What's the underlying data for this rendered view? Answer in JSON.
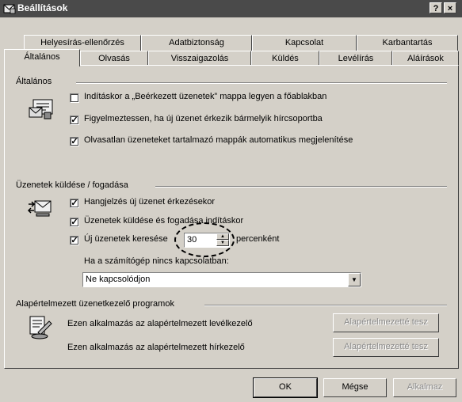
{
  "window": {
    "title": "Beállítások",
    "help_button": "?",
    "close_button": "×"
  },
  "tabs_row1": [
    "Helyesírás-ellenőrzés",
    "Adatbiztonság",
    "Kapcsolat",
    "Karbantartás"
  ],
  "tabs_row2": [
    "Általános",
    "Olvasás",
    "Visszaigazolás",
    "Küldés",
    "Levélírás",
    "Aláírások"
  ],
  "active_tab": "Általános",
  "general": {
    "heading": "Általános",
    "options": [
      {
        "label": "Indításkor a „Beérkezett üzenetek” mappa legyen a főablakban",
        "checked": false
      },
      {
        "label": "Figyelmeztessen, ha új üzenet érkezik bármelyik hírcsoportba",
        "checked": true
      },
      {
        "label": "Olvasatlan üzeneteket tartalmazó mappák automatikus megjelenítése",
        "checked": true
      }
    ]
  },
  "send_receive": {
    "heading": "Üzenetek küldése / fogadása",
    "options": [
      {
        "label": "Hangjelzés új üzenet érkezésekor",
        "checked": true
      },
      {
        "label": "Üzenetek küldése és fogadása indításkor",
        "checked": true
      },
      {
        "label": "Új üzenetek keresése",
        "checked": true
      }
    ],
    "interval_value": "30",
    "interval_suffix": "percenként",
    "offline_label": "Ha a számítógép nincs kapcsolatban:",
    "offline_selected": "Ne kapcsolódjon"
  },
  "default_programs": {
    "heading": "Alapértelmezett üzenetkezelő programok",
    "mail_text": "Ezen alkalmazás az alapértelmezett levélkezelő",
    "news_text": "Ezen alkalmazás az alapértelmezett hírkezelő",
    "mail_button": "Alapértelmezetté tesz",
    "news_button": "Alapértelmezetté tesz"
  },
  "footer": {
    "ok": "OK",
    "cancel": "Mégse",
    "apply": "Alkalmaz"
  }
}
